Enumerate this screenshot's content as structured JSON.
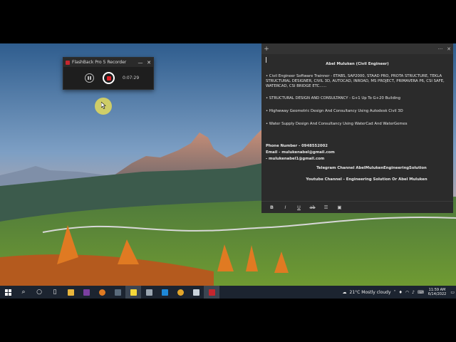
{
  "recorder": {
    "title": "FlashBack Pro 5 Recorder",
    "minimize": "—",
    "close": "✕",
    "timer": "0:07:29"
  },
  "note": {
    "add": "+",
    "menu": "···",
    "close": "✕",
    "heading": "Abel Muluken (Civil Engineer)",
    "bullets": [
      "• Civil Engineer Software Trainner - ETABS, SAP2000, STAAD PRO, PROTA STRUCTURE, TEKLA STRUCTURAL DESIGNER, CIVIL 3D, AUTOCAD, INROAD, MS PROJECT, PRIMAVERA P6, CSI SAFE, WATERCAD, CSI BRIDGE ETC......",
      "• STRUCTURAL DESIGN AND CONSULTANCY - G+1 Up To G+20 Building",
      "• Highwway Geometric Design And Consultancy Using Autodesk Civil 3D",
      "• Water Supply Design And Consultancy Using WaterCad And WaterGemes"
    ],
    "phone": "Phone Number - 0948552002",
    "email1": "Email - mulukenabel@gmail.com",
    "email2": "- mulukenabel1@gmail.com",
    "telegram": "Telegram Channel AbelMulukenEngineeringSolution",
    "youtube": "Youtube Channel - Engineering Solution Or Abel Muluken",
    "toolbar": [
      "B",
      "I",
      "U",
      "ab",
      "☰",
      "▣"
    ]
  },
  "taskbar": {
    "weather": "21°C  Mostly cloudy",
    "time": "11:59 AM",
    "date": "6/14/2022",
    "colors": {
      "taskbar": "#1c2430",
      "record": "#e0242a"
    }
  }
}
